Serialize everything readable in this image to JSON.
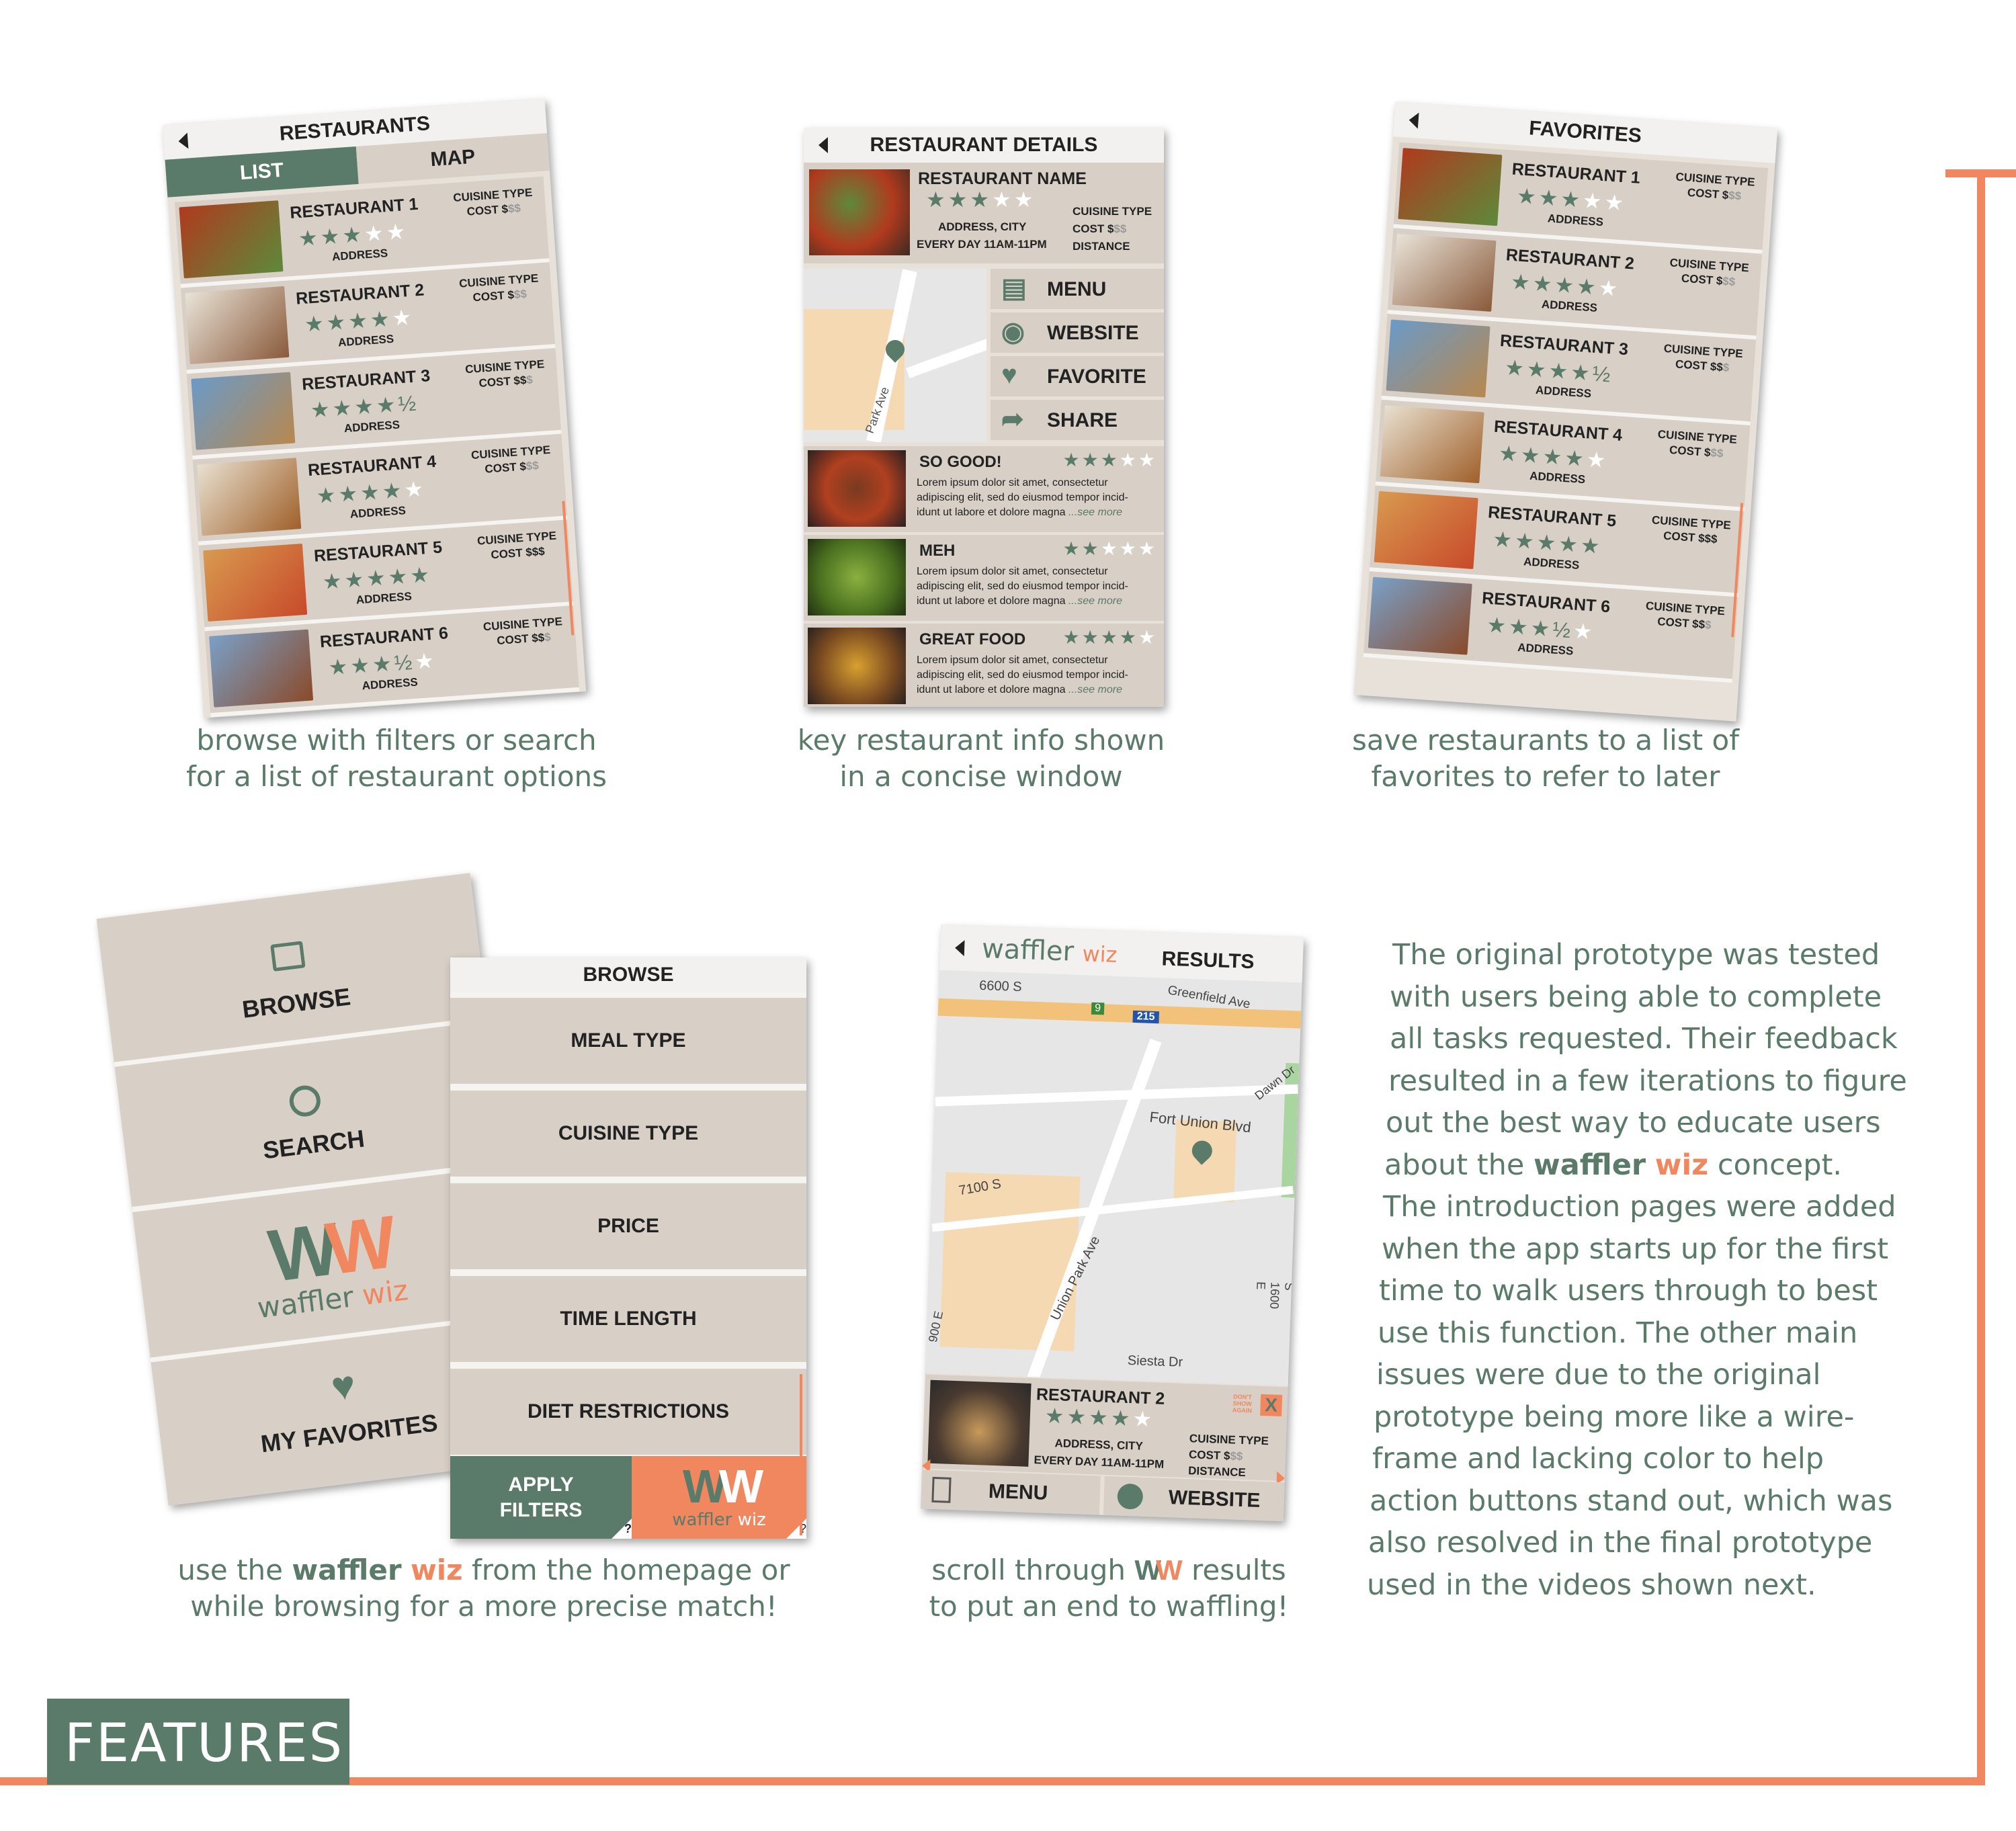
{
  "colors": {
    "green": "#5b7b6a",
    "orange": "#f0875f",
    "beige": "#d8cfc6"
  },
  "list_screen": {
    "title": "RESTAURANTS",
    "tabs": [
      "LIST",
      "MAP"
    ],
    "rows": [
      {
        "name": "RESTAURANT 1",
        "stars": "★★★",
        "empty": "★★",
        "cuisine": "CUISINE TYPE",
        "cost": "COST $",
        "cost_dim": "$$",
        "address": "ADDRESS"
      },
      {
        "name": "RESTAURANT 2",
        "stars": "★★★★",
        "empty": "★",
        "cuisine": "CUISINE TYPE",
        "cost": "COST $",
        "cost_dim": "$$",
        "address": "ADDRESS"
      },
      {
        "name": "RESTAURANT 3",
        "stars": "★★★★½",
        "empty": "",
        "cuisine": "CUISINE TYPE",
        "cost": "COST $$",
        "cost_dim": "$",
        "address": "ADDRESS"
      },
      {
        "name": "RESTAURANT 4",
        "stars": "★★★★",
        "empty": "★",
        "cuisine": "CUISINE TYPE",
        "cost": "COST $",
        "cost_dim": "$$",
        "address": "ADDRESS"
      },
      {
        "name": "RESTAURANT 5",
        "stars": "★★★★★",
        "empty": "",
        "cuisine": "CUISINE TYPE",
        "cost": "COST $$$",
        "cost_dim": "",
        "address": "ADDRESS"
      },
      {
        "name": "RESTAURANT 6",
        "stars": "★★★½",
        "empty": "★",
        "cuisine": "CUISINE TYPE",
        "cost": "COST $$",
        "cost_dim": "$",
        "address": "ADDRESS"
      }
    ],
    "caption_line1": "browse with filters or search",
    "caption_line2": "for a list of restaurant options"
  },
  "details_screen": {
    "title": "RESTAURANT DETAILS",
    "name": "RESTAURANT NAME",
    "stars": "★★★",
    "empty": "★★",
    "address": "ADDRESS, CITY",
    "hours": "EVERY DAY 11AM-11PM",
    "cuisine": "CUISINE TYPE",
    "cost": "COST $",
    "cost_dim": "$$",
    "distance": "DISTANCE",
    "street": "Park Ave",
    "actions": [
      "MENU",
      "WEBSITE",
      "FAVORITE",
      "SHARE"
    ],
    "reviews": [
      {
        "title": "SO GOOD!",
        "stars": "★★★",
        "empty": "★★",
        "text1": "Lorem ipsum dolor sit amet, consectetur",
        "text2": "adipiscing elit, sed do eiusmod tempor incid-",
        "text3": "idunt ut labore et dolore magna ",
        "more": "...see more"
      },
      {
        "title": "MEH",
        "stars": "★★",
        "empty": "★★★",
        "text1": "Lorem ipsum dolor sit amet, consectetur",
        "text2": "adipiscing elit, sed do eiusmod tempor incid-",
        "text3": "idunt ut labore et dolore magna ",
        "more": "...see more"
      },
      {
        "title": "GREAT FOOD",
        "stars": "★★★★",
        "empty": "★",
        "text1": "Lorem ipsum dolor sit amet, consectetur",
        "text2": "adipiscing elit, sed do eiusmod tempor incid-",
        "text3": "idunt ut labore et dolore magna ",
        "more": "...see more"
      }
    ],
    "caption_line1": "key restaurant info shown",
    "caption_line2": "in a concise window"
  },
  "favorites_screen": {
    "title": "FAVORITES",
    "rows": [
      {
        "name": "RESTAURANT 1",
        "stars": "★★★",
        "empty": "★★",
        "cuisine": "CUISINE TYPE",
        "cost": "COST $",
        "cost_dim": "$$",
        "address": "ADDRESS"
      },
      {
        "name": "RESTAURANT 2",
        "stars": "★★★★",
        "empty": "★",
        "cuisine": "CUISINE TYPE",
        "cost": "COST $",
        "cost_dim": "$$",
        "address": "ADDRESS"
      },
      {
        "name": "RESTAURANT 3",
        "stars": "★★★★½",
        "empty": "",
        "cuisine": "CUISINE TYPE",
        "cost": "COST $$",
        "cost_dim": "$",
        "address": "ADDRESS"
      },
      {
        "name": "RESTAURANT 4",
        "stars": "★★★★",
        "empty": "★",
        "cuisine": "CUISINE TYPE",
        "cost": "COST $",
        "cost_dim": "$$",
        "address": "ADDRESS"
      },
      {
        "name": "RESTAURANT 5",
        "stars": "★★★★★",
        "empty": "",
        "cuisine": "CUISINE TYPE",
        "cost": "COST $$$",
        "cost_dim": "",
        "address": "ADDRESS"
      },
      {
        "name": "RESTAURANT 6",
        "stars": "★★★½",
        "empty": "★",
        "cuisine": "CUISINE TYPE",
        "cost": "COST $$",
        "cost_dim": "$",
        "address": "ADDRESS"
      }
    ],
    "caption_line1": "save restaurants to a list of",
    "caption_line2": "favorites to refer to later"
  },
  "home_screen": {
    "items": [
      "BROWSE",
      "SEARCH",
      "MY FAVORITES"
    ],
    "logo_mark": "WW",
    "logo_a": "waffler",
    "logo_b": "wiz",
    "qmark": "?"
  },
  "browse_screen": {
    "title": "BROWSE",
    "items": [
      "MEAL TYPE",
      "CUISINE TYPE",
      "PRICE",
      "TIME LENGTH",
      "DIET RESTRICTIONS"
    ],
    "apply_line1": "APPLY",
    "apply_line2": "FILTERS",
    "logo_mark": "WW",
    "logo_a": "waffler",
    "logo_b": "wiz",
    "qmark": "?"
  },
  "home_caption": {
    "pre": "use the ",
    "brand_a": "waffler",
    "brand_b": "wiz",
    "post": " from the homepage or",
    "line2": "while browsing for a more precise match!"
  },
  "results_screen": {
    "logo_a": "waffler",
    "logo_b": "wiz",
    "title": "RESULTS",
    "map_labels": [
      "6600 S",
      "Greenfield Ave",
      "Fort Union Blvd",
      "Dawn Dr",
      "7100 S",
      "Union Park Ave",
      "900 E",
      "S 1600 E",
      "Siesta Dr",
      "215",
      "9"
    ],
    "card": {
      "name": "RESTAURANT 2",
      "stars": "★★★★",
      "empty": "★",
      "address": "ADDRESS, CITY",
      "hours": "EVERY DAY 11AM-11PM",
      "cuisine": "CUISINE TYPE",
      "cost": "COST $",
      "cost_dim": "$$",
      "distance": "DISTANCE",
      "dont_show": "DON'T SHOW AGAIN",
      "close": "X"
    },
    "actions": [
      "MENU",
      "WEBSITE"
    ]
  },
  "results_caption": {
    "pre": "scroll through ",
    "mark": "WW",
    "post": " results",
    "line2": "to put an end to waffling!"
  },
  "paragraph": {
    "l1": "The original prototype was tested",
    "l2": "with users being able to complete",
    "l3": "all tasks requested. Their feedback",
    "l4": "resulted in a few iterations to figure",
    "l5": "out the best way to educate users",
    "l6_pre": "about the ",
    "l6_a": "waffler",
    "l6_b": "wiz",
    "l6_post": " concept.",
    "l7": "The introduction pages were added",
    "l8": "when the app starts up for the first",
    "l9": "time to walk users through to best",
    "l10": "use this function. The other main",
    "l11": "issues were due to the original",
    "l12": "prototype being more like a wire-",
    "l13": "frame and lacking color to help",
    "l14": "action buttons stand out, which was",
    "l15": "also resolved in the final prototype",
    "l16": "used in the videos shown next."
  },
  "section_label": "FEATURES"
}
